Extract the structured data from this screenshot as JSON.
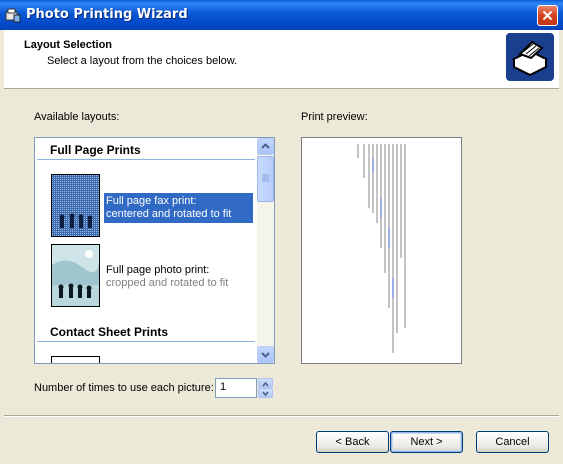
{
  "window": {
    "title": "Photo Printing Wizard"
  },
  "header": {
    "title": "Layout Selection",
    "subtitle": "Select a layout from the choices below."
  },
  "layouts": {
    "label": "Available layouts:",
    "groups": [
      {
        "name": "Full Page Prints"
      },
      {
        "name": "Contact Sheet Prints"
      }
    ],
    "items": [
      {
        "line1": "Full page fax print:",
        "line2": "centered and rotated to fit",
        "selected": true
      },
      {
        "line1": "Full page photo print:",
        "line2": "cropped and rotated to fit",
        "selected": false
      }
    ]
  },
  "preview": {
    "label": "Print preview:"
  },
  "copies": {
    "label": "Number of times to use each picture:",
    "value": "1"
  },
  "buttons": {
    "back": "< Back",
    "next": "Next >",
    "cancel": "Cancel"
  },
  "colors": {
    "selection": "#316ac5",
    "titlebar": "#0a58d6",
    "dialog": "#ece9d8"
  }
}
